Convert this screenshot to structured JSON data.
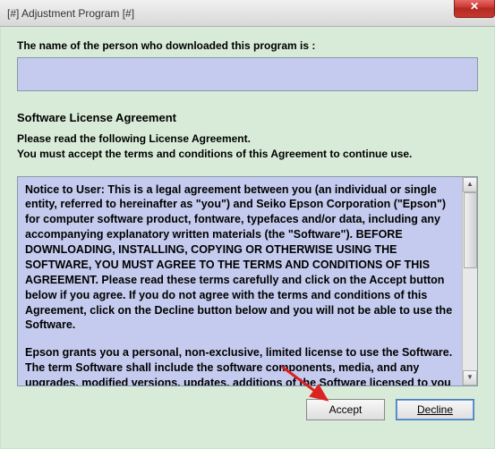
{
  "window": {
    "title": "[#] Adjustment Program [#]",
    "close_glyph": "✕"
  },
  "download_label": "The name of the person who downloaded this program is :",
  "name_value": "",
  "license_heading": "Software License Agreement",
  "instruction_line1": "Please read the following License Agreement.",
  "instruction_line2": "You must accept the terms and conditions of this Agreement to continue use.",
  "eula": {
    "para1": "Notice to User: This is a legal agreement between you (an individual or single entity, referred to hereinafter as \"you\") and Seiko Epson Corporation (\"Epson\") for computer software product, fontware, typefaces and/or data, including any accompanying explanatory written materials (the \"Software\").  BEFORE DOWNLOADING, INSTALLING, COPYING OR OTHERWISE USING THE SOFTWARE, YOU MUST AGREE TO THE TERMS AND CONDITIONS OF THIS AGREEMENT.  Please read these terms carefully and click on the Accept button below if you agree.  If you do not agree with the terms and conditions of this Agreement, click on the Decline button below and you will not be able to use the Software.",
    "para2": "Epson grants you a personal, non-exclusive, limited license to use the Software.  The term Software shall include the software components, media, and any upgrades, modified versions, updates, additions of the Software licensed to you by Epson or its suppliers.  Epson and its suppliers"
  },
  "buttons": {
    "accept": "Accept",
    "decline": "Decline"
  },
  "scroll": {
    "up": "▲",
    "down": "▼"
  }
}
